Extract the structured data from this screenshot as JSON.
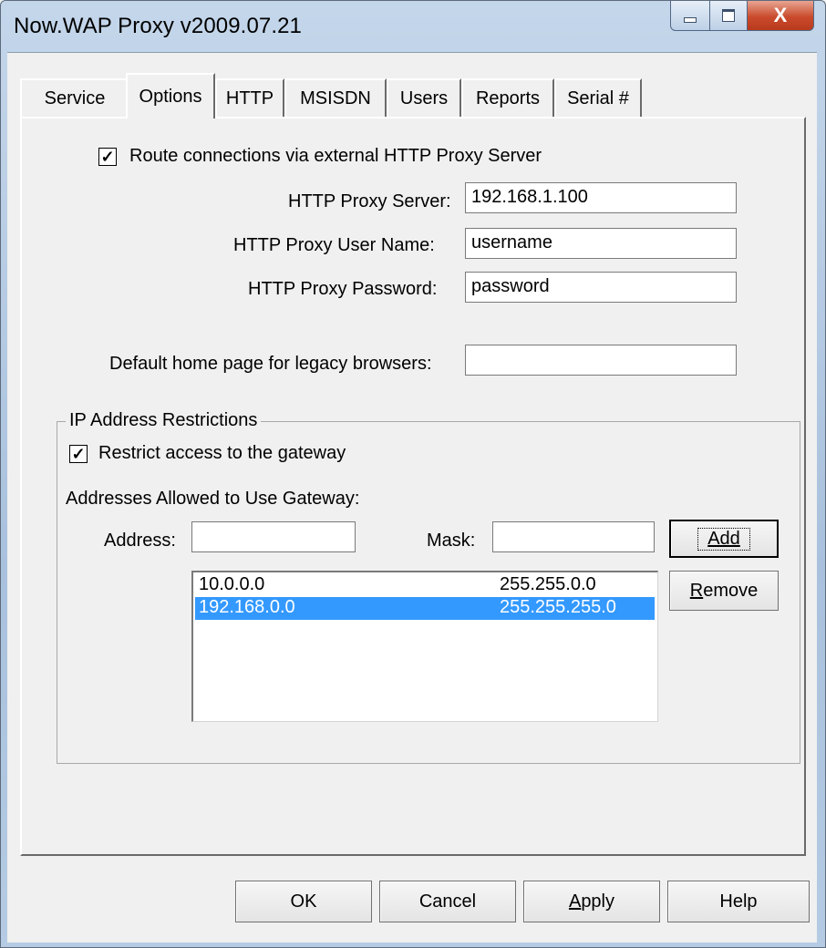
{
  "window": {
    "title": "Now.WAP Proxy v2009.07.21"
  },
  "caption": {
    "minimize_icon": "minimize-icon",
    "maximize_icon": "maximize-icon",
    "close_glyph": "X"
  },
  "tabs": [
    "Service",
    "Options",
    "HTTP",
    "MSISDN",
    "Users",
    "Reports",
    "Serial #"
  ],
  "active_tab": "Options",
  "options": {
    "route_checkbox": {
      "checked": true,
      "label": "Route connections via external HTTP Proxy Server",
      "mark": "✓"
    },
    "proxy_server": {
      "label": "HTTP Proxy Server:",
      "value": "192.168.1.100"
    },
    "proxy_user": {
      "label": "HTTP Proxy User Name:",
      "value": "username"
    },
    "proxy_password": {
      "label": "HTTP Proxy Password:",
      "value": "password"
    },
    "home_page": {
      "label": "Default home page for legacy browsers:",
      "value": ""
    }
  },
  "ip_restrictions": {
    "title": "IP Address Restrictions",
    "restrict_checkbox": {
      "checked": true,
      "label": "Restrict access to the gateway",
      "mark": "✓"
    },
    "allowed_label": "Addresses Allowed to Use Gateway:",
    "address_label": "Address:",
    "address_value": "",
    "mask_label": "Mask:",
    "mask_value": "",
    "add_button": "Add",
    "remove_button": "Remove",
    "entries": [
      {
        "address": "10.0.0.0",
        "mask": "255.255.0.0",
        "selected": false
      },
      {
        "address": "192.168.0.0",
        "mask": "255.255.255.0",
        "selected": true
      }
    ]
  },
  "footer": {
    "ok": "OK",
    "cancel": "Cancel",
    "apply": "Apply",
    "help": "Help"
  }
}
